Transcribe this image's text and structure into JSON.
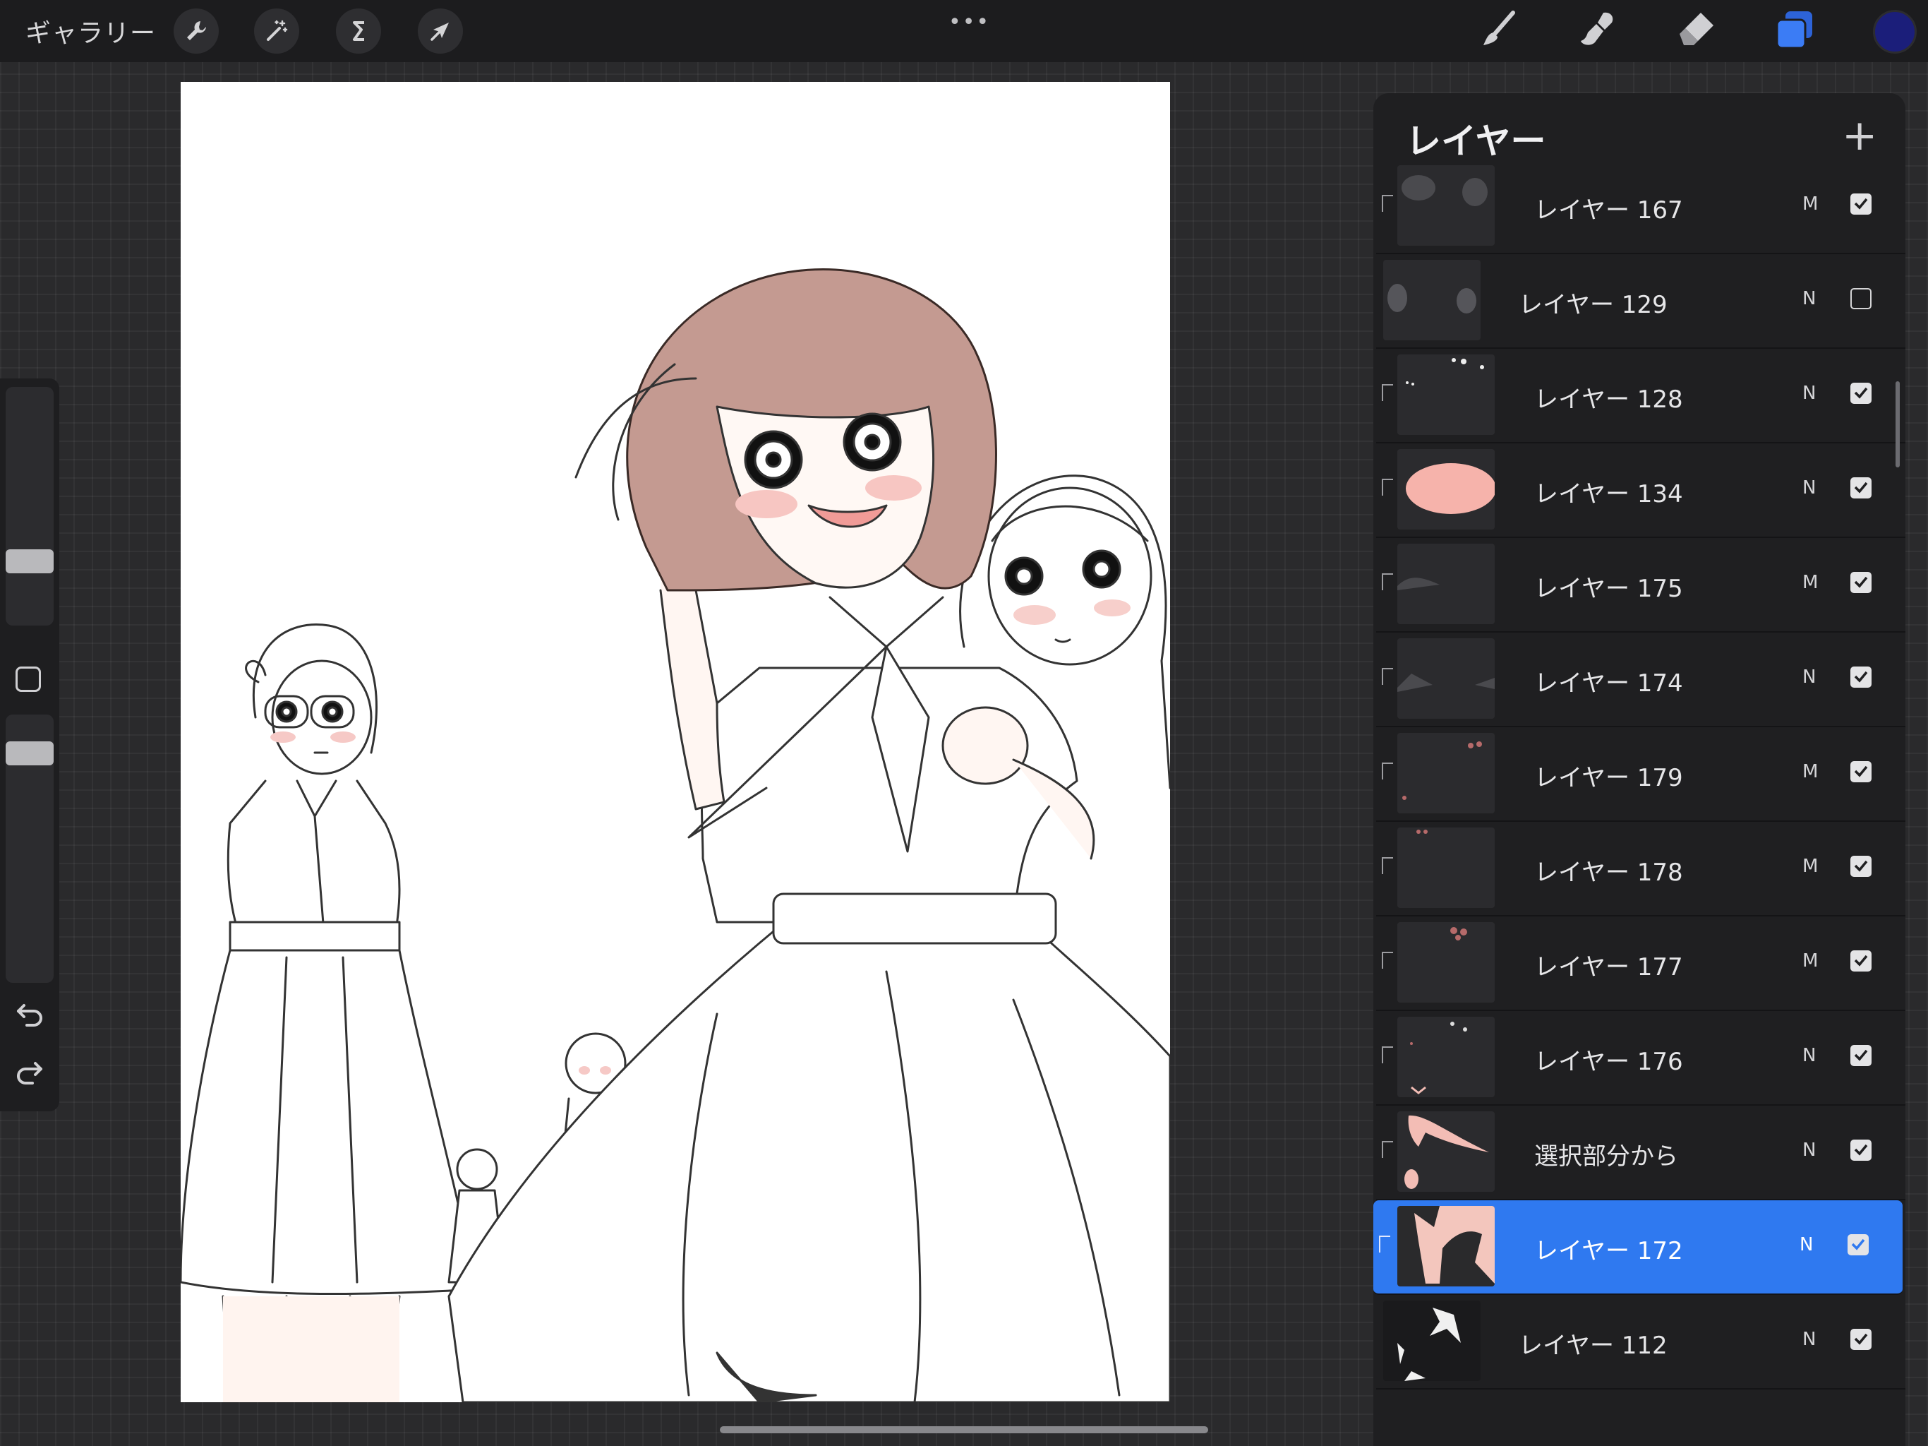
{
  "topbar": {
    "gallery_label": "ギャラリー",
    "more_glyph": "•••",
    "left_tools": [
      "wrench-icon",
      "magic-wand-icon",
      "selection-icon",
      "transform-arrow-icon"
    ],
    "right_tools": [
      "brush-icon",
      "smudge-icon",
      "eraser-icon",
      "layers-icon",
      "color-picker-icon"
    ],
    "accent_color": "#3b7cf5",
    "current_color": "#1b1e7a"
  },
  "sidebar": {
    "brush_size_level": 0.55,
    "opacity_level": 0.9
  },
  "layers_panel": {
    "title": "レイヤー",
    "add_glyph": "+",
    "layers": [
      {
        "name": "レイヤー 167",
        "blend": "M",
        "visible": true,
        "clipped": true,
        "selected": false
      },
      {
        "name": "レイヤー 129",
        "blend": "N",
        "visible": false,
        "clipped": false,
        "selected": false
      },
      {
        "name": "レイヤー 128",
        "blend": "N",
        "visible": true,
        "clipped": true,
        "selected": false
      },
      {
        "name": "レイヤー 134",
        "blend": "N",
        "visible": true,
        "clipped": true,
        "selected": false
      },
      {
        "name": "レイヤー 175",
        "blend": "M",
        "visible": true,
        "clipped": true,
        "selected": false
      },
      {
        "name": "レイヤー 174",
        "blend": "N",
        "visible": true,
        "clipped": true,
        "selected": false
      },
      {
        "name": "レイヤー 179",
        "blend": "M",
        "visible": true,
        "clipped": true,
        "selected": false
      },
      {
        "name": "レイヤー 178",
        "blend": "M",
        "visible": true,
        "clipped": true,
        "selected": false
      },
      {
        "name": "レイヤー 177",
        "blend": "M",
        "visible": true,
        "clipped": true,
        "selected": false
      },
      {
        "name": "レイヤー 176",
        "blend": "N",
        "visible": true,
        "clipped": true,
        "selected": false
      },
      {
        "name": "選択部分から",
        "blend": "N",
        "visible": true,
        "clipped": true,
        "selected": false
      },
      {
        "name": "レイヤー 172",
        "blend": "N",
        "visible": true,
        "clipped": true,
        "selected": true
      },
      {
        "name": "レイヤー 112",
        "blend": "N",
        "visible": true,
        "clipped": false,
        "selected": false
      }
    ]
  }
}
